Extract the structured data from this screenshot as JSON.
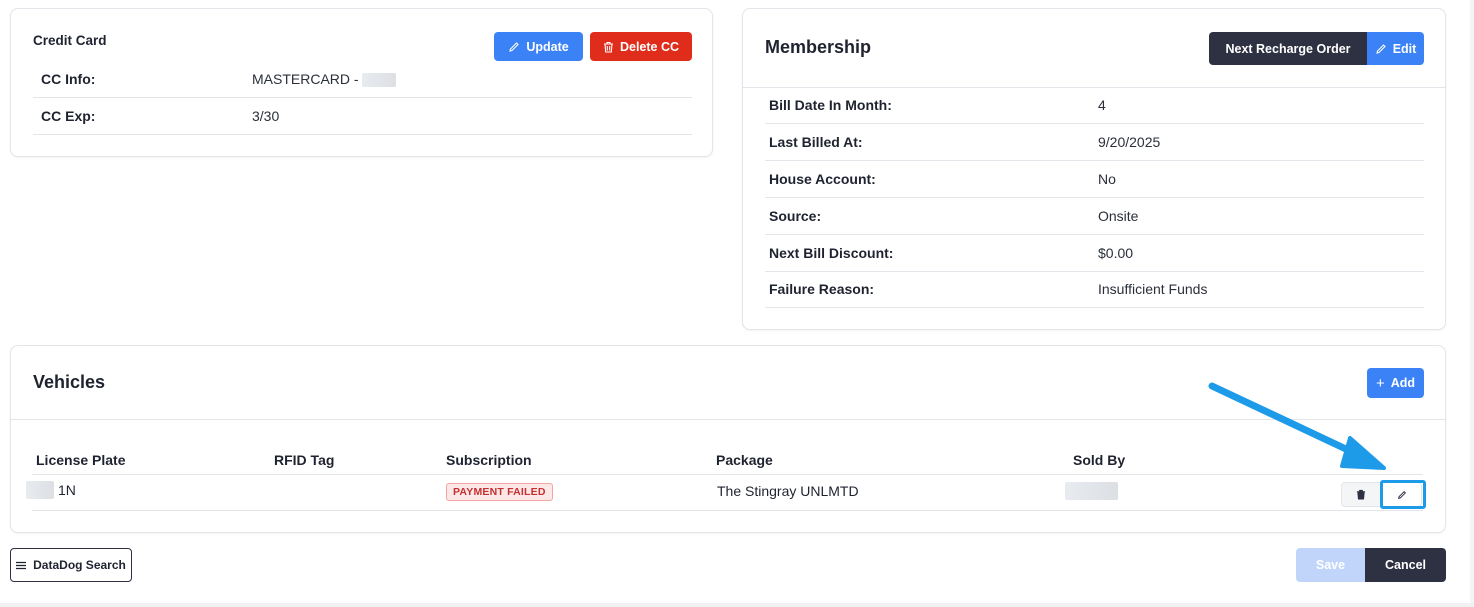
{
  "credit_card": {
    "title": "Credit Card",
    "update_label": "Update",
    "delete_label": "Delete CC",
    "rows": [
      {
        "label": "CC Info:",
        "value": "MASTERCARD - "
      },
      {
        "label": "CC Exp:",
        "value": "3/30"
      }
    ]
  },
  "membership": {
    "title": "Membership",
    "next_recharge_label": "Next Recharge Order",
    "edit_label": "Edit",
    "rows": [
      {
        "label": "Bill Date In Month:",
        "value": "4"
      },
      {
        "label": "Last Billed At:",
        "value": "9/20/2025"
      },
      {
        "label": "House Account:",
        "value": "No"
      },
      {
        "label": "Source:",
        "value": "Onsite"
      },
      {
        "label": "Next Bill Discount:",
        "value": "$0.00"
      },
      {
        "label": "Failure Reason:",
        "value": "Insufficient Funds"
      }
    ]
  },
  "vehicles": {
    "title": "Vehicles",
    "add_label": "Add",
    "columns": [
      "License Plate",
      "RFID Tag",
      "Subscription",
      "Package",
      "Sold By"
    ],
    "rows": [
      {
        "license_plate": "1N",
        "rfid_tag": "",
        "subscription": "PAYMENT FAILED",
        "package": "The Stingray UNLMTD",
        "sold_by": ""
      }
    ]
  },
  "footer": {
    "datadog_label": "DataDog Search",
    "save_label": "Save",
    "cancel_label": "Cancel"
  },
  "colors": {
    "primary_blue": "#3b82f6",
    "danger_red": "#e02d1b",
    "dark": "#2d3142",
    "annotation_arrow": "#1e9be8"
  }
}
